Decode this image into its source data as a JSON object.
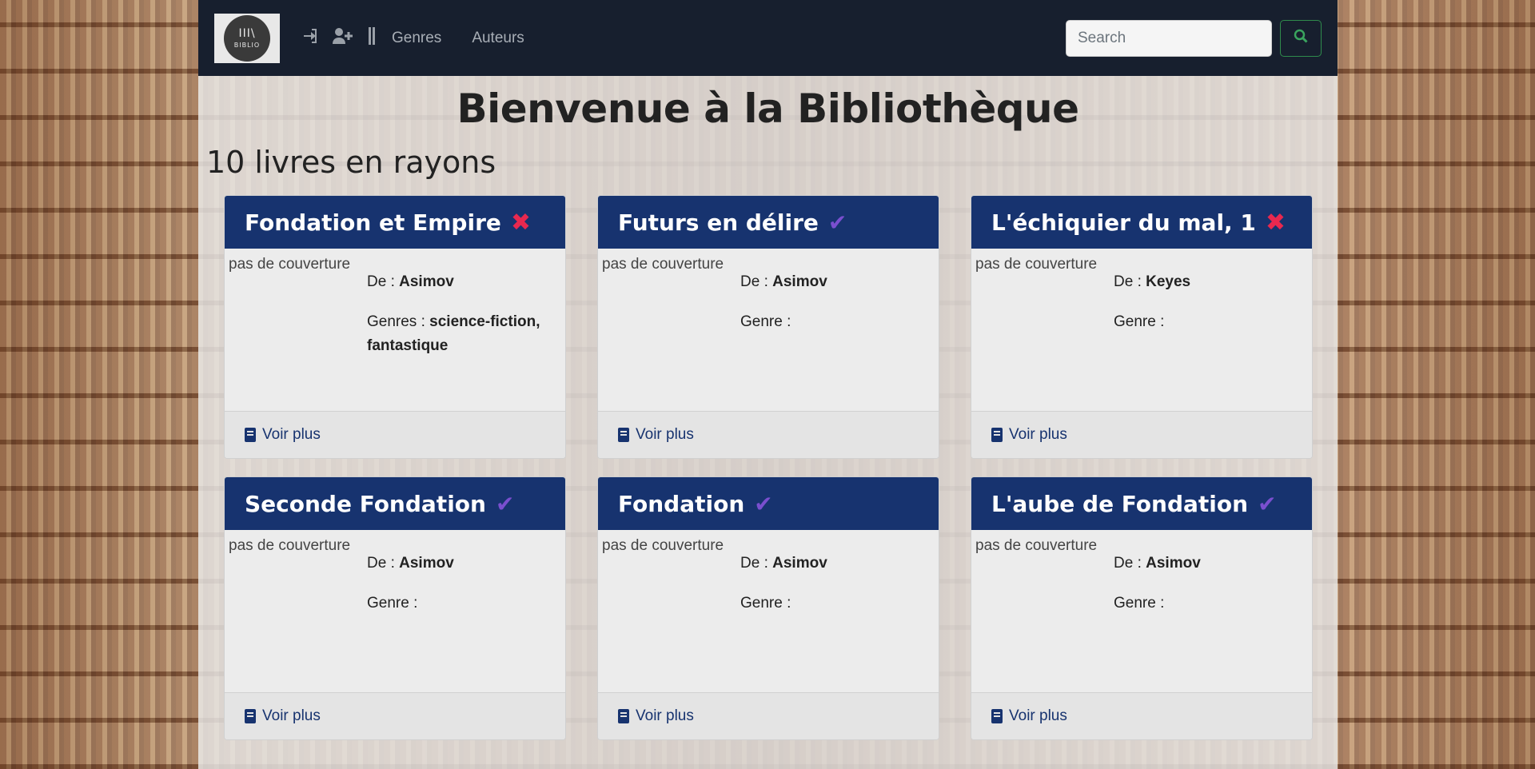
{
  "navbar": {
    "logo_text": "BIBLIO",
    "logo_bars": "III\\",
    "icons": [
      "sign-in-icon",
      "user-plus-icon",
      "separator-icon"
    ],
    "links": [
      "Genres",
      "Auteurs"
    ],
    "search": {
      "placeholder": "Search",
      "value": ""
    }
  },
  "main": {
    "title": "Bienvenue à la Bibliothèque",
    "count_label": "10 livres en rayons"
  },
  "books": [
    {
      "title": "Fondation et Empire",
      "available": false,
      "author_label": "De : ",
      "author": "Asimov",
      "genre_label": "Genres : ",
      "genres": "science-fiction, fantastique",
      "cover_alt": "pas de couverture",
      "more": "Voir plus"
    },
    {
      "title": "Futurs en délire",
      "available": true,
      "author_label": "De : ",
      "author": "Asimov",
      "genre_label": "Genre : ",
      "genres": "",
      "cover_alt": "pas de couverture",
      "more": "Voir plus"
    },
    {
      "title": "L'échiquier du mal, 1",
      "available": false,
      "author_label": "De : ",
      "author": "Keyes",
      "genre_label": "Genre : ",
      "genres": "",
      "cover_alt": "pas de couverture",
      "more": "Voir plus"
    },
    {
      "title": "Seconde Fondation",
      "available": true,
      "author_label": "De : ",
      "author": "Asimov",
      "genre_label": "Genre : ",
      "genres": "",
      "cover_alt": "pas de couverture",
      "more": "Voir plus"
    },
    {
      "title": "Fondation",
      "available": true,
      "author_label": "De : ",
      "author": "Asimov",
      "genre_label": "Genre : ",
      "genres": "",
      "cover_alt": "pas de couverture",
      "more": "Voir plus"
    },
    {
      "title": "L'aube de Fondation",
      "available": true,
      "author_label": "De : ",
      "author": "Asimov",
      "genre_label": "Genre : ",
      "genres": "",
      "cover_alt": "pas de couverture",
      "more": "Voir plus"
    }
  ],
  "status_symbols": {
    "available": "✔",
    "unavailable": "✖"
  },
  "colors": {
    "navbar": "#171f2e",
    "card_header": "#17336f",
    "unavailable": "#e8284f",
    "available": "#7a4fcf",
    "search_button": "#3aa45e"
  }
}
